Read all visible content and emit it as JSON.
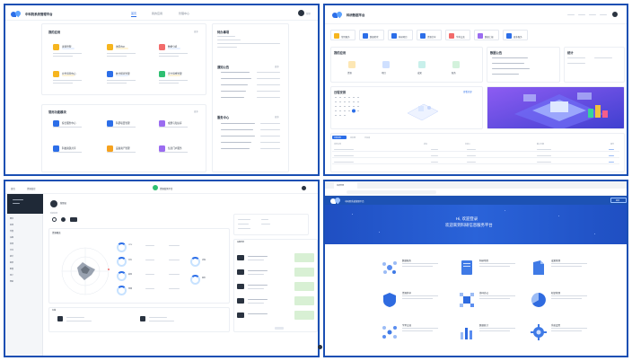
{
  "q1": {
    "app_title": "中科院系统管理平台",
    "nav": [
      {
        "label": "首页",
        "active": true
      },
      {
        "label": "我的应用"
      },
      {
        "label": "管理中心"
      }
    ],
    "user": "管理",
    "my_apps_title": "我的应用",
    "more": "更多",
    "apps": [
      {
        "name": "资源管理",
        "color": "#f6b51e",
        "tag": "#e8f0ff"
      },
      {
        "name": "协同办公",
        "color": "#f6b51e",
        "tag": "#fff3d6"
      },
      {
        "name": "数据分析",
        "color": "#f26b6b",
        "tag": "#e8f0ff"
      },
      {
        "name": "业务运营中心",
        "color": "#f6b51e",
        "tag": "#fff3d6"
      },
      {
        "name": "统计报表管理",
        "color": "#2c6ee8",
        "tag": "#e8f0ff"
      },
      {
        "name": "安全运维管理",
        "color": "#2fbf71",
        "tag": "#fff3d6"
      }
    ],
    "quick_title": "常用功能模块",
    "quick": [
      {
        "name": "综合服务中心",
        "color": "#2c6ee8"
      },
      {
        "name": "科研项目管理",
        "color": "#2c6ee8"
      },
      {
        "name": "成果与知识库",
        "color": "#9b6cf0"
      },
      {
        "name": "科技资源共享",
        "color": "#2c6ee8"
      },
      {
        "name": "设备资产管理",
        "color": "#f6a21e"
      },
      {
        "name": "信息门户服务",
        "color": "#9b6cf0"
      }
    ],
    "notice_title": "待办事项",
    "news_title": "通知公告",
    "links_title": "服务中心"
  },
  "q2": {
    "app_title": "科研数据平台",
    "tiles": [
      {
        "label": "常用服务",
        "color": "#f6b51e"
      },
      {
        "label": "数据检索",
        "color": "#2c6ee8"
      },
      {
        "label": "科研项目",
        "color": "#2c6ee8"
      },
      {
        "label": "资源共享",
        "color": "#2c6ee8"
      },
      {
        "label": "学术交流",
        "color": "#f26b6b"
      },
      {
        "label": "数据上报",
        "color": "#9b6cf0"
      },
      {
        "label": "更多服务",
        "color": "#2c6ee8"
      }
    ],
    "panel_left_title": "我的应用",
    "panel_mid_title": "数据公告",
    "panel_right_title": "统计",
    "apps": [
      {
        "label": "资源",
        "color": "#f6b51e"
      },
      {
        "label": "项目",
        "color": "#2c6ee8"
      },
      {
        "label": "成果",
        "color": "#2fbfb0"
      },
      {
        "label": "服务",
        "color": "#2fbf71"
      }
    ],
    "calendar_title": "日程安排",
    "calendar_link": "查看全部",
    "tabs": [
      "全部任务",
      "待处理",
      "已完成"
    ],
    "table_headers": [
      "任务名称",
      "状态",
      "负责人",
      "截止日期",
      "操作"
    ]
  },
  "q3": {
    "crumb": "首页",
    "module": "资源监控",
    "center_title": "资源监测平台",
    "user_name": "管理员",
    "profile_title": "系统资源",
    "chart_title": "资源概览",
    "device_title": "设备列表",
    "side_items": [
      "概览",
      "监测",
      "告警",
      "设备",
      "资源",
      "日志",
      "统计",
      "报表",
      "配置",
      "用户",
      "帮助"
    ],
    "rings": [
      "CPU",
      "内存",
      "磁盘",
      "网络",
      "进程",
      "服务"
    ],
    "bottom_title": "存储"
  },
  "q4": {
    "tab_label": "科研管理",
    "app_title": "中科院系统管理平台",
    "login_button": "登录",
    "hero_line1": "Hi, 欢迎登录",
    "hero_line2": "欢迎来到科研信息服务平台",
    "features": [
      {
        "name": "数据服务",
        "color": "#5a8df0"
      },
      {
        "name": "科研项目",
        "color": "#3f7ae6"
      },
      {
        "name": "成果管理",
        "color": "#3f7ae6"
      },
      {
        "name": "资源共享",
        "color": "#2f6be0"
      },
      {
        "name": "协同办公",
        "color": "#2f6be0"
      },
      {
        "name": "知识管理",
        "color": "#2f6be0"
      },
      {
        "name": "学术交流",
        "color": "#3f7ae6"
      },
      {
        "name": "数据统计",
        "color": "#2f6be0"
      },
      {
        "name": "系统设置",
        "color": "#3f7ae6"
      }
    ]
  },
  "colors": {
    "frame": "#1a4fb3",
    "primary": "#2c6ee8"
  }
}
